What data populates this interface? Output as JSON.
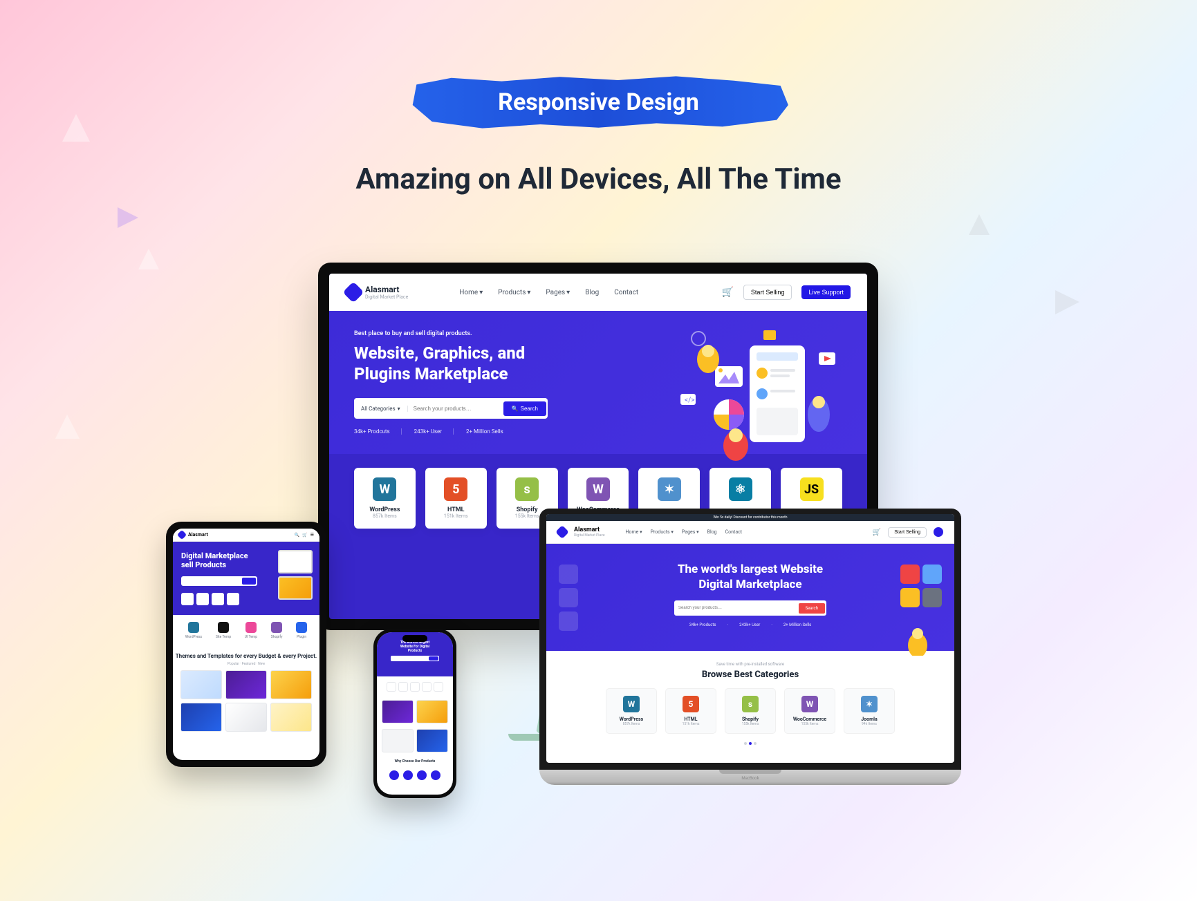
{
  "banner": {
    "badge": "Responsive Design",
    "subheadline": "Amazing on All Devices, All The Time"
  },
  "brand": {
    "name": "Alasmart",
    "tagline": "Digital Market Place"
  },
  "nav": {
    "items": [
      "Home",
      "Products",
      "Pages",
      "Blog",
      "Contact"
    ],
    "start_selling": "Start Selling",
    "live_support": "Live Support"
  },
  "desktop_hero": {
    "eyebrow": "Best place to buy and sell digital products.",
    "title": "Website, Graphics, and Plugins Marketplace",
    "search_category": "All Categories",
    "search_placeholder": "Search your products…",
    "search_button": "Search",
    "stats": [
      "34k+ Prodcuts",
      "243k+ User",
      "2+ Million Sells"
    ]
  },
  "categories": [
    {
      "name": "WordPress",
      "count": "857k Items",
      "icon": "W",
      "cls": "c-wp"
    },
    {
      "name": "HTML",
      "count": "151k Items",
      "icon": "5",
      "cls": "c-html"
    },
    {
      "name": "Shopify",
      "count": "155k Items",
      "icon": "s",
      "cls": "c-shop"
    },
    {
      "name": "WooCommerce",
      "count": "155k Items",
      "icon": "W",
      "cls": "c-woo"
    },
    {
      "name": "",
      "count": "",
      "icon": "✶",
      "cls": "c-joom"
    },
    {
      "name": "",
      "count": "",
      "icon": "⚛",
      "cls": "c-react"
    },
    {
      "name": "",
      "count": "",
      "icon": "JS",
      "cls": "c-js"
    }
  ],
  "tablet": {
    "hero_title": "Digital Marketplace sell Products",
    "section_title": "Themes and Templates for every Budget & every Project."
  },
  "phone": {
    "hero_title": "The world's largest Website For Digital Products"
  },
  "laptop": {
    "topbar": "Win 5x daily! Discount for contributor this month",
    "hero_title_1": "The world's largest Website",
    "hero_title_2": "Digital Marketplace",
    "search_button": "Search",
    "stats": [
      "34k+ Products",
      "243k+ User",
      "2+ Million Sells"
    ],
    "browse_eyebrow": "Save time with pre-installed software",
    "browse_title": "Browse Best Categories",
    "categories": [
      {
        "name": "WordPress",
        "count": "857k Items",
        "icon": "W",
        "cls": "c-wp"
      },
      {
        "name": "HTML",
        "count": "151k Items",
        "icon": "5",
        "cls": "c-html"
      },
      {
        "name": "Shopify",
        "count": "155k Items",
        "icon": "s",
        "cls": "c-shop"
      },
      {
        "name": "WooCommerce",
        "count": "155k Items",
        "icon": "W",
        "cls": "c-woo"
      },
      {
        "name": "Joomla",
        "count": "94k Items",
        "icon": "✶",
        "cls": "c-joom"
      }
    ],
    "macbook_label": "MacBook"
  }
}
